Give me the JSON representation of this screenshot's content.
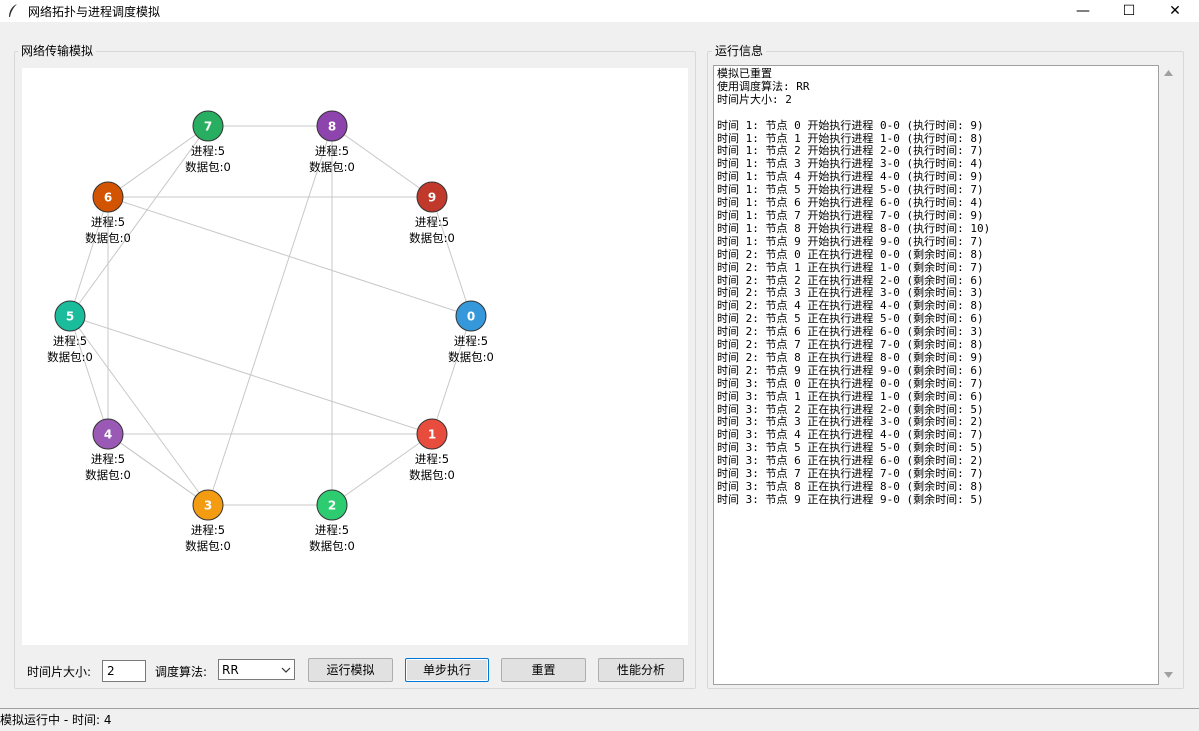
{
  "window": {
    "title": "网络拓扑与进程调度模拟",
    "controls": {
      "minimize": "—",
      "maximize": "☐",
      "close": "✕"
    }
  },
  "network_panel": {
    "label": "网络传输模拟",
    "nodes": [
      {
        "id": "0",
        "color": "#3498db",
        "process": "进程:5",
        "packets": "数据包:0"
      },
      {
        "id": "1",
        "color": "#e74c3c",
        "process": "进程:5",
        "packets": "数据包:0"
      },
      {
        "id": "2",
        "color": "#2ecc71",
        "process": "进程:5",
        "packets": "数据包:0"
      },
      {
        "id": "3",
        "color": "#f39c12",
        "process": "进程:5",
        "packets": "数据包:0"
      },
      {
        "id": "4",
        "color": "#9b59b6",
        "process": "进程:5",
        "packets": "数据包:0"
      },
      {
        "id": "5",
        "color": "#1abc9c",
        "process": "进程:5",
        "packets": "数据包:0"
      },
      {
        "id": "6",
        "color": "#d35400",
        "process": "进程:5",
        "packets": "数据包:0"
      },
      {
        "id": "7",
        "color": "#27ae60",
        "process": "进程:5",
        "packets": "数据包:0"
      },
      {
        "id": "8",
        "color": "#8e44ad",
        "process": "进程:5",
        "packets": "数据包:0"
      },
      {
        "id": "9",
        "color": "#c0392b",
        "process": "进程:5",
        "packets": "数据包:0"
      }
    ],
    "edges": [
      [
        0,
        1
      ],
      [
        1,
        2
      ],
      [
        2,
        3
      ],
      [
        3,
        4
      ],
      [
        4,
        5
      ],
      [
        5,
        6
      ],
      [
        6,
        7
      ],
      [
        7,
        8
      ],
      [
        8,
        9
      ],
      [
        9,
        0
      ],
      [
        6,
        0
      ],
      [
        5,
        1
      ],
      [
        4,
        1
      ],
      [
        4,
        6
      ],
      [
        5,
        7
      ],
      [
        5,
        3
      ],
      [
        6,
        9
      ],
      [
        3,
        8
      ],
      [
        2,
        8
      ],
      [
        3,
        4
      ]
    ]
  },
  "controls": {
    "time_quantum_label": "时间片大小:",
    "time_quantum_value": "2",
    "algorithm_label": "调度算法:",
    "algorithm_value": "RR",
    "run_button": "运行模拟",
    "step_button": "单步执行",
    "reset_button": "重置",
    "analysis_button": "性能分析"
  },
  "log_panel": {
    "label": "运行信息",
    "lines": [
      "模拟已重置",
      "使用调度算法: RR",
      "时间片大小: 2",
      "",
      "时间 1: 节点 0 开始执行进程 0-0 (执行时间: 9)",
      "时间 1: 节点 1 开始执行进程 1-0 (执行时间: 8)",
      "时间 1: 节点 2 开始执行进程 2-0 (执行时间: 7)",
      "时间 1: 节点 3 开始执行进程 3-0 (执行时间: 4)",
      "时间 1: 节点 4 开始执行进程 4-0 (执行时间: 9)",
      "时间 1: 节点 5 开始执行进程 5-0 (执行时间: 7)",
      "时间 1: 节点 6 开始执行进程 6-0 (执行时间: 4)",
      "时间 1: 节点 7 开始执行进程 7-0 (执行时间: 9)",
      "时间 1: 节点 8 开始执行进程 8-0 (执行时间: 10)",
      "时间 1: 节点 9 开始执行进程 9-0 (执行时间: 7)",
      "时间 2: 节点 0 正在执行进程 0-0 (剩余时间: 8)",
      "时间 2: 节点 1 正在执行进程 1-0 (剩余时间: 7)",
      "时间 2: 节点 2 正在执行进程 2-0 (剩余时间: 6)",
      "时间 2: 节点 3 正在执行进程 3-0 (剩余时间: 3)",
      "时间 2: 节点 4 正在执行进程 4-0 (剩余时间: 8)",
      "时间 2: 节点 5 正在执行进程 5-0 (剩余时间: 6)",
      "时间 2: 节点 6 正在执行进程 6-0 (剩余时间: 3)",
      "时间 2: 节点 7 正在执行进程 7-0 (剩余时间: 8)",
      "时间 2: 节点 8 正在执行进程 8-0 (剩余时间: 9)",
      "时间 2: 节点 9 正在执行进程 9-0 (剩余时间: 6)",
      "时间 3: 节点 0 正在执行进程 0-0 (剩余时间: 7)",
      "时间 3: 节点 1 正在执行进程 1-0 (剩余时间: 6)",
      "时间 3: 节点 2 正在执行进程 2-0 (剩余时间: 5)",
      "时间 3: 节点 3 正在执行进程 3-0 (剩余时间: 2)",
      "时间 3: 节点 4 正在执行进程 4-0 (剩余时间: 7)",
      "时间 3: 节点 5 正在执行进程 5-0 (剩余时间: 5)",
      "时间 3: 节点 6 正在执行进程 6-0 (剩余时间: 2)",
      "时间 3: 节点 7 正在执行进程 7-0 (剩余时间: 7)",
      "时间 3: 节点 8 正在执行进程 8-0 (剩余时间: 8)",
      "时间 3: 节点 9 正在执行进程 9-0 (剩余时间: 5)"
    ]
  },
  "status": "模拟运行中 - 时间: 4"
}
